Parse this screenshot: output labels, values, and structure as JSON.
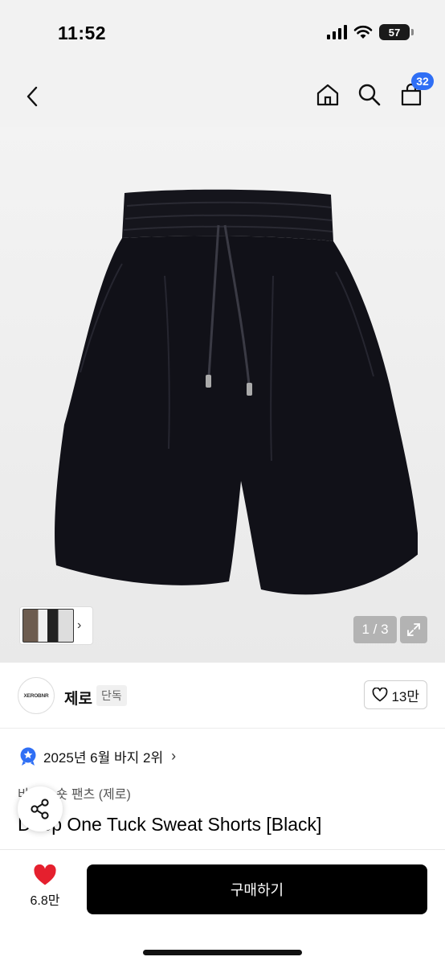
{
  "status": {
    "time": "11:52",
    "battery": "57"
  },
  "nav": {
    "cart_count": "32"
  },
  "gallery": {
    "counter": "1 / 3"
  },
  "brand": {
    "logo_text": "XEROBNR",
    "name": "제로",
    "tag": "단독",
    "likes": "13만"
  },
  "ranking": {
    "text": "2025년 6월 바지 2위"
  },
  "product": {
    "category": "바지 > 숏 팬츠 (제로)",
    "title": "Deep One Tuck Sweat Shorts [Black]"
  },
  "bottom": {
    "wish_count": "6.8만",
    "buy_label": "구매하기"
  },
  "colors": {
    "accent": "#2f6ff5",
    "like": "#e5202e",
    "buy": "#000000"
  }
}
